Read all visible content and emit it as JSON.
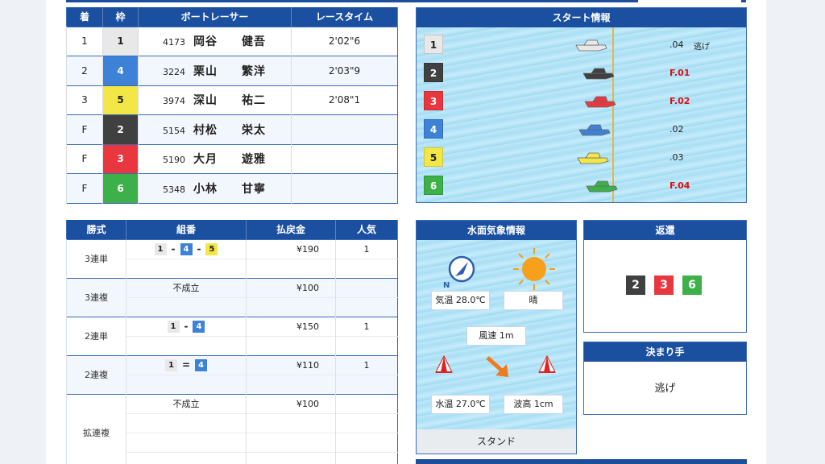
{
  "results": {
    "headers": [
      "着",
      "枠",
      "ボートレーサー",
      "レースタイム"
    ],
    "rows": [
      {
        "place": "1",
        "boat": "1",
        "reg": "4173",
        "name": "岡谷　　健吾",
        "time": "2'02\"6"
      },
      {
        "place": "2",
        "boat": "4",
        "reg": "3224",
        "name": "栗山　　繁洋",
        "time": "2'03\"9"
      },
      {
        "place": "3",
        "boat": "5",
        "reg": "3974",
        "name": "深山　　祐二",
        "time": "2'08\"1"
      },
      {
        "place": "F",
        "boat": "2",
        "reg": "5154",
        "name": "村松　　栄太",
        "time": ""
      },
      {
        "place": "F",
        "boat": "3",
        "reg": "5190",
        "name": "大月　　遊雅",
        "time": ""
      },
      {
        "place": "F",
        "boat": "6",
        "reg": "5348",
        "name": "小林　　甘寧",
        "time": ""
      }
    ]
  },
  "start": {
    "title": "スタート情報",
    "rows": [
      {
        "boat": "1",
        "time": ".04",
        "technique": "逃げ",
        "flying": false
      },
      {
        "boat": "2",
        "time": "F.01",
        "technique": "",
        "flying": true
      },
      {
        "boat": "3",
        "time": "F.02",
        "technique": "",
        "flying": true
      },
      {
        "boat": "4",
        "time": ".02",
        "technique": "",
        "flying": false
      },
      {
        "boat": "5",
        "time": ".03",
        "technique": "",
        "flying": false
      },
      {
        "boat": "6",
        "time": "F.04",
        "technique": "",
        "flying": true
      }
    ]
  },
  "payout": {
    "headers": [
      "勝式",
      "組番",
      "払戻金",
      "人気"
    ],
    "groups": [
      {
        "type": "3連単",
        "rows": [
          {
            "combo": [
              "1",
              "4",
              "5"
            ],
            "sep": "-",
            "text": "",
            "amount": "¥190",
            "pop": "1"
          },
          {
            "combo": [],
            "sep": "",
            "text": "",
            "amount": "",
            "pop": ""
          }
        ]
      },
      {
        "type": "3連複",
        "rows": [
          {
            "combo": [],
            "sep": "",
            "text": "不成立",
            "amount": "¥100",
            "pop": ""
          },
          {
            "combo": [],
            "sep": "",
            "text": "",
            "amount": "",
            "pop": ""
          }
        ]
      },
      {
        "type": "2連単",
        "rows": [
          {
            "combo": [
              "1",
              "4"
            ],
            "sep": "-",
            "text": "",
            "amount": "¥150",
            "pop": "1"
          },
          {
            "combo": [],
            "sep": "",
            "text": "",
            "amount": "",
            "pop": ""
          }
        ]
      },
      {
        "type": "2連複",
        "rows": [
          {
            "combo": [
              "1",
              "4"
            ],
            "sep": "=",
            "text": "",
            "amount": "¥110",
            "pop": "1"
          },
          {
            "combo": [],
            "sep": "",
            "text": "",
            "amount": "",
            "pop": ""
          }
        ]
      },
      {
        "type": "拡連複",
        "rows": [
          {
            "combo": [],
            "sep": "",
            "text": "不成立",
            "amount": "¥100",
            "pop": ""
          },
          {
            "combo": [],
            "sep": "",
            "text": "",
            "amount": "",
            "pop": ""
          },
          {
            "combo": [],
            "sep": "",
            "text": "",
            "amount": "",
            "pop": ""
          },
          {
            "combo": [],
            "sep": "",
            "text": "",
            "amount": "",
            "pop": ""
          }
        ]
      }
    ]
  },
  "weather": {
    "title": "水面気象情報",
    "compass_label": "N",
    "air_temp": "気温 28.0℃",
    "condition": "晴",
    "wind_speed": "風速 1m",
    "water_temp": "水温 27.0℃",
    "wave_height": "波高 1cm",
    "footer": "スタンド"
  },
  "refund": {
    "title": "返還",
    "boats": [
      "2",
      "3",
      "6"
    ]
  },
  "kimarite": {
    "title": "決まり手",
    "value": "逃げ"
  },
  "colors": {
    "header_blue": "#1b4fa0",
    "boat1": "#e8e8e8",
    "boat2": "#404040",
    "boat3": "#e8373f",
    "boat4": "#3d82d6",
    "boat5": "#f3e748",
    "boat6": "#3db049"
  }
}
